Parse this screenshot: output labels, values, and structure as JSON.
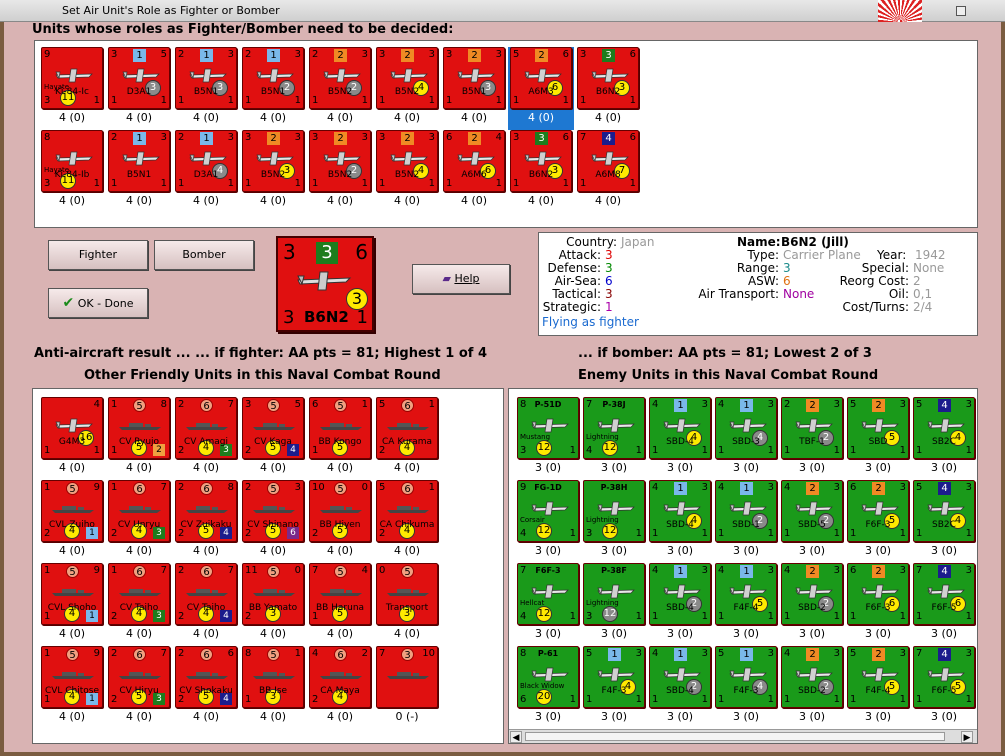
{
  "window": {
    "title": "Set Air Unit's Role as Fighter or Bomber"
  },
  "header_top": "Units whose roles as Fighter/Bomber need to be decided:",
  "pending_units": [
    {
      "name": "Ki-84-Ic",
      "tl": "9",
      "tc": "",
      "tr": "",
      "bl": "3",
      "br": "1",
      "ball": "11",
      "ball_pos": "bl",
      "nick": "Hayate",
      "val": "4 (0)"
    },
    {
      "name": "D3A1",
      "tl": "3",
      "tc": "1",
      "tcc": "blue",
      "tr": "5",
      "bl": "1",
      "br": "1",
      "ball": "3",
      "ballc": "grey",
      "val": "4 (0)"
    },
    {
      "name": "B5N1",
      "tl": "2",
      "tc": "1",
      "tcc": "blue",
      "tr": "3",
      "bl": "1",
      "br": "1",
      "ball": "3",
      "ballc": "grey",
      "val": "4 (0)"
    },
    {
      "name": "B5N1",
      "tl": "2",
      "tc": "1",
      "tcc": "blue",
      "tr": "3",
      "bl": "1",
      "br": "1",
      "ball": "2",
      "ballc": "grey",
      "val": "4 (0)"
    },
    {
      "name": "B5N2",
      "tl": "2",
      "tc": "2",
      "tcc": "orange",
      "tr": "3",
      "bl": "1",
      "br": "1",
      "ball": "2",
      "ballc": "grey",
      "val": "4 (0)"
    },
    {
      "name": "B5N2",
      "tl": "3",
      "tc": "2",
      "tcc": "orange",
      "tr": "3",
      "bl": "1",
      "br": "1",
      "ball": "4",
      "val": "4 (0)"
    },
    {
      "name": "B5N1",
      "tl": "3",
      "tc": "2",
      "tcc": "orange",
      "tr": "3",
      "bl": "1",
      "br": "1",
      "ball": "3",
      "ballc": "grey",
      "val": "4 (0)"
    },
    {
      "name": "A6M3",
      "tl": "5",
      "tc": "2",
      "tcc": "orange",
      "tr": "6",
      "bl": "1",
      "br": "1",
      "ball": "6",
      "val": "4 (0)",
      "selected": true
    },
    {
      "name": "B6N2",
      "tl": "3",
      "tc": "3",
      "tcc": "green",
      "tr": "6",
      "bl": "1",
      "br": "1",
      "ball": "3",
      "val": "4 (0)"
    },
    {
      "name": "Ki-84-Ib",
      "tl": "8",
      "tc": "",
      "tr": "",
      "bl": "3",
      "br": "1",
      "ball": "11",
      "ball_pos": "bl",
      "nick": "Hayate",
      "val": "4 (0)"
    },
    {
      "name": "B5N1",
      "tl": "2",
      "tc": "1",
      "tcc": "blue",
      "tr": "3",
      "bl": "1",
      "br": "1",
      "ball": "",
      "val": "4 (0)"
    },
    {
      "name": "D3A1",
      "tl": "2",
      "tc": "1",
      "tcc": "blue",
      "tr": "3",
      "bl": "1",
      "br": "1",
      "ball": "4",
      "ballc": "grey",
      "val": "4 (0)"
    },
    {
      "name": "B5N2",
      "tl": "3",
      "tc": "2",
      "tcc": "orange",
      "tr": "3",
      "bl": "1",
      "br": "1",
      "ball": "3",
      "val": "4 (0)"
    },
    {
      "name": "B5N2",
      "tl": "3",
      "tc": "2",
      "tcc": "orange",
      "tr": "3",
      "bl": "1",
      "br": "1",
      "ball": "2",
      "ballc": "grey",
      "val": "4 (0)"
    },
    {
      "name": "B5N2",
      "tl": "3",
      "tc": "2",
      "tcc": "orange",
      "tr": "3",
      "bl": "1",
      "br": "1",
      "ball": "4",
      "val": "4 (0)"
    },
    {
      "name": "A6M6",
      "tl": "6",
      "tc": "2",
      "tcc": "orange",
      "tr": "4",
      "bl": "1",
      "br": "1",
      "ball": "6",
      "val": "4 (0)"
    },
    {
      "name": "B6N2",
      "tl": "3",
      "tc": "3",
      "tcc": "green",
      "tr": "6",
      "bl": "1",
      "br": "1",
      "ball": "3",
      "val": "4 (0)"
    },
    {
      "name": "A6M8",
      "tl": "7",
      "tc": "4",
      "tcc": "navy",
      "tr": "6",
      "bl": "1",
      "br": "1",
      "ball": "7",
      "val": "4 (0)"
    }
  ],
  "buttons": {
    "fighter": "Fighter",
    "bomber": "Bomber",
    "ok": "OK - Done",
    "help": "Help"
  },
  "big_counter": {
    "tl": "3",
    "tc": "3",
    "tr": "6",
    "bl": "3",
    "name": "B6N2",
    "br": "1",
    "ball": "3"
  },
  "info": {
    "country_label": "Country:",
    "country": "Japan",
    "attack_label": "Attack:",
    "attack": "3",
    "defense_label": "Defense:",
    "defense": "3",
    "airsea_label": "Air-Sea:",
    "airsea": "6",
    "tactical_label": "Tactical:",
    "tactical": "3",
    "strategic_label": "Strategic:",
    "strategic": "1",
    "flying": "Flying as fighter",
    "name_label": "Name:",
    "name": "B6N2 (Jill)",
    "type_label": "Type:",
    "type": "Carrier Plane",
    "year_label": "Year:",
    "year": "1942",
    "range_label": "Range:",
    "range": "3",
    "special_label": "Special:",
    "special": "None",
    "asw_label": "ASW:",
    "asw": "6",
    "reorg_label": "Reorg Cost:",
    "reorg": "2",
    "airtransport_label": "Air Transport:",
    "airtransport": "None",
    "oil_label": "Oil:",
    "oil": "0,1",
    "cost_label": "Cost/Turns:",
    "cost": "2/4"
  },
  "aa": {
    "left": "Anti-aircraft result ...      ... if fighter:  AA pts = 81; Highest 1 of 4",
    "right": "... if bomber:  AA pts = 81; Lowest 2 of 3"
  },
  "friendly_header": "Other Friendly Units in this Naval Combat Round",
  "enemy_header": "Enemy Units in this Naval Combat Round",
  "friendly_units": [
    {
      "kind": "plane",
      "name": "G4M3",
      "tl": "",
      "tc": "",
      "tr": "4",
      "bl": "1",
      "br": "1",
      "ball": "16",
      "val": "4 (0)"
    },
    {
      "kind": "ship",
      "name": "CV Ryujo",
      "tl": "1",
      "tc": "5",
      "tr": "8",
      "bl": "1",
      "bc": "5",
      "sq": "2",
      "sqc": "orange",
      "val": "4 (0)"
    },
    {
      "kind": "ship",
      "name": "CV Amagi",
      "tl": "2",
      "tc": "6",
      "tr": "7",
      "bl": "2",
      "bc": "4",
      "sq": "3",
      "sqc": "green",
      "val": "4 (0)"
    },
    {
      "kind": "ship",
      "name": "CV Kaga",
      "tl": "3",
      "tc": "5",
      "tr": "5",
      "bl": "2",
      "bc": "5",
      "sq": "4",
      "sqc": "navy",
      "val": "4 (0)"
    },
    {
      "kind": "ship",
      "name": "BB Kongo",
      "tl": "6",
      "tc": "5",
      "tr": "1",
      "bl": "1",
      "bc": "5",
      "sq": "",
      "val": "4 (0)"
    },
    {
      "kind": "ship",
      "name": "CA Kurama",
      "tl": "5",
      "tc": "6",
      "tr": "1",
      "bl": "2",
      "bc": "4",
      "sq": "",
      "val": "4 (0)"
    },
    {
      "kind": "ship",
      "name": "CVL Zuiho",
      "tl": "1",
      "tc": "5",
      "tr": "9",
      "bl": "2",
      "bc": "4",
      "sq": "1",
      "sqc": "blue",
      "val": "4 (0)"
    },
    {
      "kind": "ship",
      "name": "CV Unryu",
      "tl": "1",
      "tc": "6",
      "tr": "7",
      "bl": "2",
      "bc": "4",
      "sq": "3",
      "sqc": "green",
      "val": "4 (0)"
    },
    {
      "kind": "ship",
      "name": "CV Zuikaku",
      "tl": "2",
      "tc": "6",
      "tr": "8",
      "bl": "2",
      "bc": "5",
      "sq": "4",
      "sqc": "navy",
      "val": "4 (0)"
    },
    {
      "kind": "ship",
      "name": "CV Shinano",
      "tl": "2",
      "tc": "5",
      "tr": "3",
      "bl": "2",
      "bc": "5",
      "sq": "6",
      "sqc": "purple",
      "val": "4 (0)"
    },
    {
      "kind": "ship",
      "name": "BB Hiyen",
      "tl": "10",
      "tc": "5",
      "tr": "0",
      "bl": "2",
      "bc": "5",
      "sq": "",
      "val": "4 (0)"
    },
    {
      "kind": "ship",
      "name": "CA Chikuma",
      "tl": "5",
      "tc": "6",
      "tr": "1",
      "bl": "2",
      "bc": "4",
      "sq": "",
      "val": "4 (0)"
    },
    {
      "kind": "ship",
      "name": "CVL Shoho",
      "tl": "1",
      "tc": "5",
      "tr": "9",
      "bl": "1",
      "bc": "4",
      "sq": "1",
      "sqc": "blue",
      "val": "4 (0)"
    },
    {
      "kind": "ship",
      "name": "CV Taiho",
      "tl": "1",
      "tc": "6",
      "tr": "7",
      "bl": "2",
      "bc": "4",
      "sq": "3",
      "sqc": "green",
      "val": "4 (0)"
    },
    {
      "kind": "ship",
      "name": "CV Taiho",
      "tl": "2",
      "tc": "6",
      "tr": "7",
      "bl": "2",
      "bc": "4",
      "sq": "4",
      "sqc": "navy",
      "val": "4 (0)"
    },
    {
      "kind": "ship",
      "name": "BB Yamato",
      "tl": "11",
      "tc": "5",
      "tr": "0",
      "bl": "2",
      "bc": "3",
      "sq": "",
      "val": "4 (0)"
    },
    {
      "kind": "ship",
      "name": "BB Haruna",
      "tl": "7",
      "tc": "5",
      "tr": "4",
      "bl": "1",
      "bc": "5",
      "sq": "",
      "val": "4 (0)"
    },
    {
      "kind": "ship",
      "name": "Transport",
      "tl": "0",
      "tc": "5",
      "tr": "",
      "bl": "",
      "bc": "3",
      "sq": "",
      "val": "4 (0)"
    },
    {
      "kind": "ship",
      "name": "CVL Chitose",
      "tl": "1",
      "tc": "5",
      "tr": "9",
      "bl": "1",
      "bc": "4",
      "sq": "1",
      "sqc": "blue",
      "val": "4 (0)"
    },
    {
      "kind": "ship",
      "name": "CV Hiryu",
      "tl": "2",
      "tc": "6",
      "tr": "7",
      "bl": "2",
      "bc": "5",
      "sq": "3",
      "sqc": "green",
      "val": "4 (0)"
    },
    {
      "kind": "ship",
      "name": "CV Shokaku",
      "tl": "2",
      "tc": "6",
      "tr": "6",
      "bl": "2",
      "bc": "5",
      "sq": "4",
      "sqc": "navy",
      "val": "4 (0)"
    },
    {
      "kind": "ship",
      "name": "BB Ise",
      "tl": "8",
      "tc": "5",
      "tr": "1",
      "bl": "1",
      "bc": "3",
      "sq": "",
      "val": "4 (0)"
    },
    {
      "kind": "ship",
      "name": "CA Maya",
      "tl": "4",
      "tc": "6",
      "tr": "2",
      "bl": "2",
      "bc": "4",
      "sq": "",
      "val": "4 (0)"
    },
    {
      "kind": "ship",
      "name": "",
      "tl": "7",
      "tc": "3",
      "tr": "10",
      "bl": "",
      "bc": "",
      "sq": "",
      "val": "0 (-)"
    }
  ],
  "enemy_units": [
    {
      "name": "P-51D",
      "top": true,
      "nick": "Mustang",
      "tl": "8",
      "tr": "",
      "bl": "3",
      "br": "1",
      "ball": "12",
      "ballpos": "bl",
      "val": "3 (0)"
    },
    {
      "name": "P-38J",
      "top": true,
      "nick": "Lightning",
      "tl": "7",
      "tr": "",
      "bl": "4",
      "br": "1",
      "ball": "12",
      "ballpos": "bl",
      "val": "3 (0)"
    },
    {
      "name": "SBD-4",
      "tl": "4",
      "tc": "1",
      "tcc": "blue",
      "tr": "3",
      "bl": "1",
      "br": "1",
      "ball": "4",
      "val": "3 (0)"
    },
    {
      "name": "SBD-3",
      "tl": "4",
      "tc": "1",
      "tcc": "blue",
      "tr": "3",
      "bl": "1",
      "br": "1",
      "ball": "4",
      "ballc": "grey",
      "val": "3 (0)"
    },
    {
      "name": "TBF-1",
      "tl": "2",
      "tc": "2",
      "tcc": "orange",
      "tr": "3",
      "bl": "1",
      "br": "1",
      "ball": "2",
      "ballc": "grey",
      "val": "3 (0)"
    },
    {
      "name": "SBD",
      "tl": "5",
      "tc": "2",
      "tcc": "orange",
      "tr": "3",
      "bl": "1",
      "br": "1",
      "ball": "5",
      "val": "3 (0)"
    },
    {
      "name": "SB2C",
      "tl": "5",
      "tc": "4",
      "tcc": "navy",
      "tr": "3",
      "bl": "1",
      "br": "1",
      "ball": "4",
      "val": "3 (0)"
    },
    {
      "name": "FG-1D",
      "top": true,
      "nick": "Corsair",
      "tl": "9",
      "tr": "",
      "bl": "4",
      "br": "1",
      "ball": "12",
      "ballpos": "bl",
      "val": "3 (0)"
    },
    {
      "name": "P-38H",
      "top": true,
      "nick": "Lightning",
      "tl": "",
      "tr": "",
      "bl": "3",
      "br": "1",
      "ball": "12",
      "ballpos": "bl",
      "val": "3 (0)"
    },
    {
      "name": "SBD-4",
      "tl": "4",
      "tc": "1",
      "tcc": "blue",
      "tr": "3",
      "bl": "1",
      "br": "1",
      "ball": "4",
      "val": "3 (0)"
    },
    {
      "name": "SBD-1",
      "tl": "4",
      "tc": "1",
      "tcc": "blue",
      "tr": "3",
      "bl": "1",
      "br": "1",
      "ball": "2",
      "ballc": "grey",
      "val": "3 (0)"
    },
    {
      "name": "SBD-5",
      "tl": "4",
      "tc": "2",
      "tcc": "orange",
      "tr": "3",
      "bl": "1",
      "br": "1",
      "ball": "2",
      "ballc": "grey",
      "val": "3 (0)"
    },
    {
      "name": "F6F-3",
      "tl": "6",
      "tc": "2",
      "tcc": "orange",
      "tr": "3",
      "bl": "1",
      "br": "1",
      "ball": "5",
      "val": "3 (0)"
    },
    {
      "name": "SB2C",
      "tl": "5",
      "tc": "4",
      "tcc": "navy",
      "tr": "3",
      "bl": "1",
      "br": "1",
      "ball": "4",
      "val": "3 (0)"
    },
    {
      "name": "F6F-3",
      "top": true,
      "nick": "Hellcat",
      "tl": "7",
      "tr": "",
      "bl": "4",
      "br": "1",
      "ball": "12",
      "ballpos": "bl",
      "val": "3 (0)"
    },
    {
      "name": "P-38F",
      "top": true,
      "nick": "Lightning",
      "tl": "",
      "tr": "",
      "bl": "3",
      "br": "1",
      "ball": "12",
      "ballpos": "bl",
      "ballc": "grey",
      "val": "3 (0)"
    },
    {
      "name": "SBD-4",
      "tl": "4",
      "tc": "1",
      "tcc": "blue",
      "tr": "3",
      "bl": "1",
      "br": "1",
      "ball": "2",
      "ballc": "grey",
      "val": "3 (0)"
    },
    {
      "name": "F4F-4",
      "tl": "4",
      "tc": "1",
      "tcc": "blue",
      "tr": "3",
      "bl": "1",
      "br": "1",
      "ball": "5",
      "val": "3 (0)"
    },
    {
      "name": "SBD-2",
      "tl": "4",
      "tc": "2",
      "tcc": "orange",
      "tr": "3",
      "bl": "1",
      "br": "1",
      "ball": "2",
      "ballc": "grey",
      "val": "3 (0)"
    },
    {
      "name": "F6F-3",
      "tl": "6",
      "tc": "2",
      "tcc": "orange",
      "tr": "3",
      "bl": "1",
      "br": "1",
      "ball": "6",
      "val": "3 (0)"
    },
    {
      "name": "F6F-5",
      "tl": "7",
      "tc": "4",
      "tcc": "navy",
      "tr": "3",
      "bl": "1",
      "br": "1",
      "ball": "6",
      "val": "3 (0)"
    },
    {
      "name": "P-61",
      "top": true,
      "nick": "Black Widow",
      "tl": "8",
      "tr": "",
      "bl": "6",
      "br": "1",
      "ball": "20",
      "ballpos": "bl",
      "val": "3 (0)"
    },
    {
      "name": "F4F-3",
      "tl": "5",
      "tc": "1",
      "tcc": "blue",
      "tr": "3",
      "bl": "1",
      "br": "1",
      "ball": "4",
      "val": "3 (0)"
    },
    {
      "name": "SBD-4",
      "tl": "4",
      "tc": "1",
      "tcc": "blue",
      "tr": "3",
      "bl": "1",
      "br": "1",
      "ball": "2",
      "ballc": "grey",
      "val": "3 (0)"
    },
    {
      "name": "F4F-3",
      "tl": "5",
      "tc": "1",
      "tcc": "blue",
      "tr": "3",
      "bl": "1",
      "br": "1",
      "ball": "4",
      "ballc": "grey",
      "val": "3 (0)"
    },
    {
      "name": "SBD-2",
      "tl": "4",
      "tc": "2",
      "tcc": "orange",
      "tr": "3",
      "bl": "1",
      "br": "1",
      "ball": "2",
      "ballc": "grey",
      "val": "3 (0)"
    },
    {
      "name": "F4F-4",
      "tl": "5",
      "tc": "2",
      "tcc": "orange",
      "tr": "3",
      "bl": "1",
      "br": "1",
      "ball": "5",
      "val": "3 (0)"
    },
    {
      "name": "F6F-5",
      "tl": "7",
      "tc": "4",
      "tcc": "navy",
      "tr": "3",
      "bl": "1",
      "br": "1",
      "ball": "5",
      "val": "3 (0)"
    }
  ]
}
